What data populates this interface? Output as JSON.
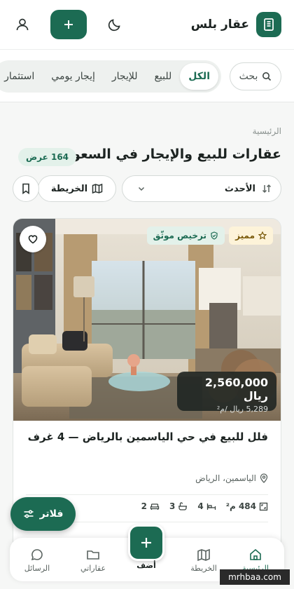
{
  "header": {
    "brand_name": "عقار بلس",
    "icons": {
      "logo": "building-icon",
      "add": "plus-icon",
      "theme": "moon-icon",
      "profile": "user-icon"
    }
  },
  "tabs": {
    "search_label": "بحث",
    "items": [
      {
        "label": "الكل",
        "active": true
      },
      {
        "label": "للبيع",
        "active": false
      },
      {
        "label": "للإيجار",
        "active": false
      },
      {
        "label": "إيجار يومي",
        "active": false
      },
      {
        "label": "استثمار",
        "active": false
      }
    ]
  },
  "listing": {
    "breadcrumb": "الرئيسية",
    "title": "عقارات للبيع والإيجار في السعودية",
    "count_badge": "164 عرض",
    "sort_value": "الأحدث",
    "map_label": "الخريطة"
  },
  "card": {
    "badge_featured": "مميز",
    "badge_license": "ترخيص موثّق",
    "price": "2,560,000 ريال",
    "price_per_meter": "5,289 ريال /م²",
    "title": "فلل للبيع في حي الياسمين بالرياض — 4 غرف",
    "location": "الياسمين، الرياض",
    "area": "484 م²",
    "rooms": "4",
    "baths": "3",
    "living": "2"
  },
  "filter_label": "فلاتر",
  "bottom_nav": {
    "home": "الرئيسية",
    "map": "الخريطة",
    "add": "أضف",
    "my_properties": "عقاراتي",
    "messages": "الرسائل"
  },
  "watermark": "mrhbaa.com",
  "colors": {
    "brand": "#1c6b53",
    "featured_bg": "#fdf3d9",
    "license_bg": "#e3f1ea"
  }
}
